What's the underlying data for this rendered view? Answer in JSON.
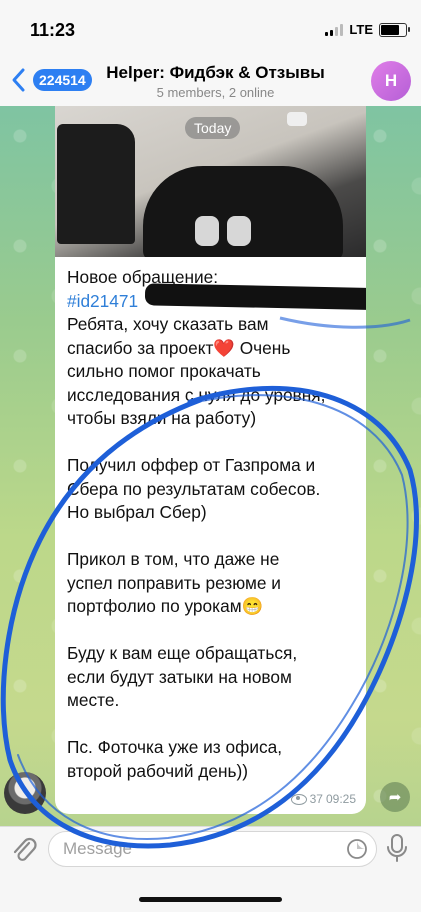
{
  "status_bar": {
    "time": "11:23",
    "network": "LTE",
    "signal_bars": 2,
    "signal_total": 4,
    "battery_level": 0.7
  },
  "nav": {
    "back_badge": "224514",
    "title": "Helper: Фидбэк & Отзывы",
    "subtitle": "5 members, 2 online",
    "avatar_letter": "H"
  },
  "photo": {
    "date_chip": "Today"
  },
  "message": {
    "header": "Новое обращение:",
    "hashtag": "#id21471",
    "lines": [
      "Ребята, хочу сказать вам",
      "спасибо за проект❤️ Очень",
      "сильно помог прокачать",
      "исследования с нуля до уровня,",
      "чтобы взяли на работу)",
      "",
      "Получил оффер от Газпрома и",
      "Сбера по результатам собесов.",
      "Но выбрал Сбер)",
      "",
      "Прикол в том, что даже не",
      "успел поправить резюме и",
      "портфолио по урокам😁",
      "",
      "Буду к вам еще обращаться,",
      "если будут затыки на новом",
      "месте.",
      "",
      "Пс. Фоточка уже из офиса,",
      "второй рабочий день))"
    ],
    "views": "37",
    "time": "09:25"
  },
  "input": {
    "placeholder": "Message"
  },
  "colors": {
    "accent": "#2d7ff2",
    "hashtag": "#2f7fd8",
    "ink": "#1e5fd8"
  }
}
